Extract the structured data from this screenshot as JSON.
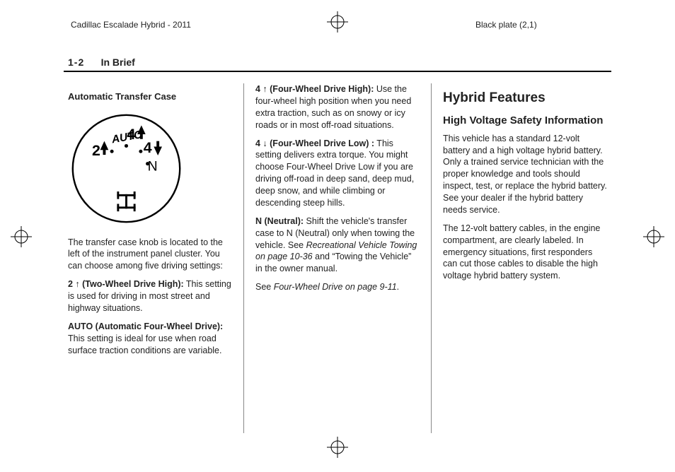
{
  "header": {
    "docname": "Cadillac Escalade Hybrid - 2011",
    "plate": "Black plate (2,1)"
  },
  "page": {
    "number": "1-2",
    "section": "In Brief"
  },
  "dial": {
    "labels": {
      "auto": "AUTO",
      "two_up": "2",
      "four_up": "4",
      "four_down": "4",
      "n": "N"
    }
  },
  "col1": {
    "heading": "Automatic Transfer Case",
    "para_loc": "The transfer case knob is located to the left of the instrument panel cluster. You can choose among five driving settings:",
    "two_hi_label": "2 ↑ (Two-Wheel Drive High):",
    "two_hi_body": "  This setting is used for driving in most street and highway situations.",
    "auto_label": "AUTO (Automatic Four-Wheel Drive):",
    "auto_body": "  This setting is ideal for use when road surface traction conditions are variable."
  },
  "col2": {
    "four_hi_label": "4 ↑ (Four-Wheel Drive High):",
    "four_hi_body": "  Use the four-wheel high position when you need extra traction, such as on snowy or icy roads or in most off-road situations.",
    "four_lo_label": "4 ↓ (Four-Wheel Drive Low) :",
    "four_lo_body": "  This setting delivers extra torque. You might choose Four-Wheel Drive Low if you are driving off-road in deep sand, deep mud, deep snow, and while climbing or descending steep hills.",
    "n_label": "N (Neutral):",
    "n_body_a": "  Shift the vehicle's transfer case to N (Neutral) only when towing the vehicle. See ",
    "n_ref1": "Recreational Vehicle Towing on page 10‑36",
    "n_body_b": " and “Towing the Vehicle” in the owner manual.",
    "see_a": "See ",
    "see_ref": "Four-Wheel Drive on page 9‑11",
    "see_b": "."
  },
  "col3": {
    "h1": "Hybrid Features",
    "h2": "High Voltage Safety Information",
    "p1": "This vehicle has a standard 12-volt battery and a high voltage hybrid battery. Only a trained service technician with the proper knowledge and tools should inspect, test, or replace the hybrid battery. See your dealer if the hybrid battery needs service.",
    "p2": "The 12-volt battery cables, in the engine compartment, are clearly labeled. In emergency situations, first responders can cut those cables to disable the high voltage hybrid battery system."
  }
}
